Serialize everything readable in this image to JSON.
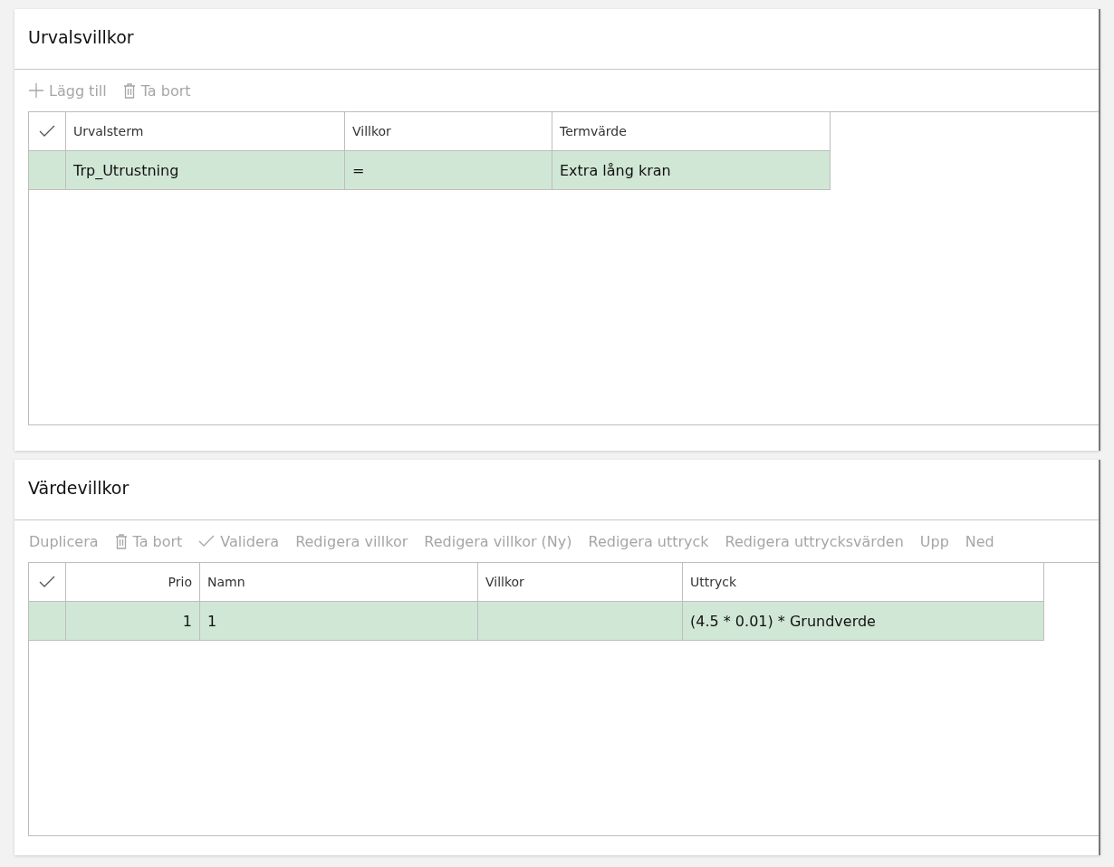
{
  "sections": [
    {
      "title": "Urvalsvillkor",
      "toolbar": [
        {
          "label": "Lägg till",
          "kind": "plus",
          "disabled": true
        },
        {
          "label": "Ta bort",
          "kind": "trash",
          "disabled": true
        }
      ],
      "table": {
        "columns": [
          {
            "label": "Urvalsterm",
            "kind": "text"
          },
          {
            "label": "Villkor",
            "kind": "text"
          },
          {
            "label": "Termvärde",
            "kind": "text"
          }
        ],
        "rows": [
          {
            "selected": true,
            "cells": [
              "Trp_Utrustning",
              "=",
              "Extra lång kran"
            ]
          }
        ]
      }
    },
    {
      "title": "Värdevillkor",
      "toolbar": [
        {
          "label": "Duplicera",
          "kind": "text",
          "disabled": true
        },
        {
          "label": "Ta bort",
          "kind": "trash",
          "disabled": true
        },
        {
          "label": "Validera",
          "kind": "check",
          "disabled": true
        },
        {
          "label": "Redigera villkor",
          "kind": "text",
          "disabled": true
        },
        {
          "label": "Redigera villkor (Ny)",
          "kind": "text",
          "disabled": true
        },
        {
          "label": "Redigera uttryck",
          "kind": "text",
          "disabled": true
        },
        {
          "label": "Redigera uttrycksvärden",
          "kind": "text",
          "disabled": true
        },
        {
          "label": "Upp",
          "kind": "text",
          "disabled": true
        },
        {
          "label": "Ned",
          "kind": "text",
          "disabled": true
        }
      ],
      "table": {
        "columns": [
          {
            "label": "Prio",
            "kind": "number"
          },
          {
            "label": "Namn",
            "kind": "text"
          },
          {
            "label": "Villkor",
            "kind": "text"
          },
          {
            "label": "Uttryck",
            "kind": "text"
          }
        ],
        "rows": [
          {
            "selected": true,
            "cells": [
              "1",
              "1",
              "",
              "(4.5 * 0.01) * Grundverde"
            ]
          }
        ]
      }
    }
  ]
}
